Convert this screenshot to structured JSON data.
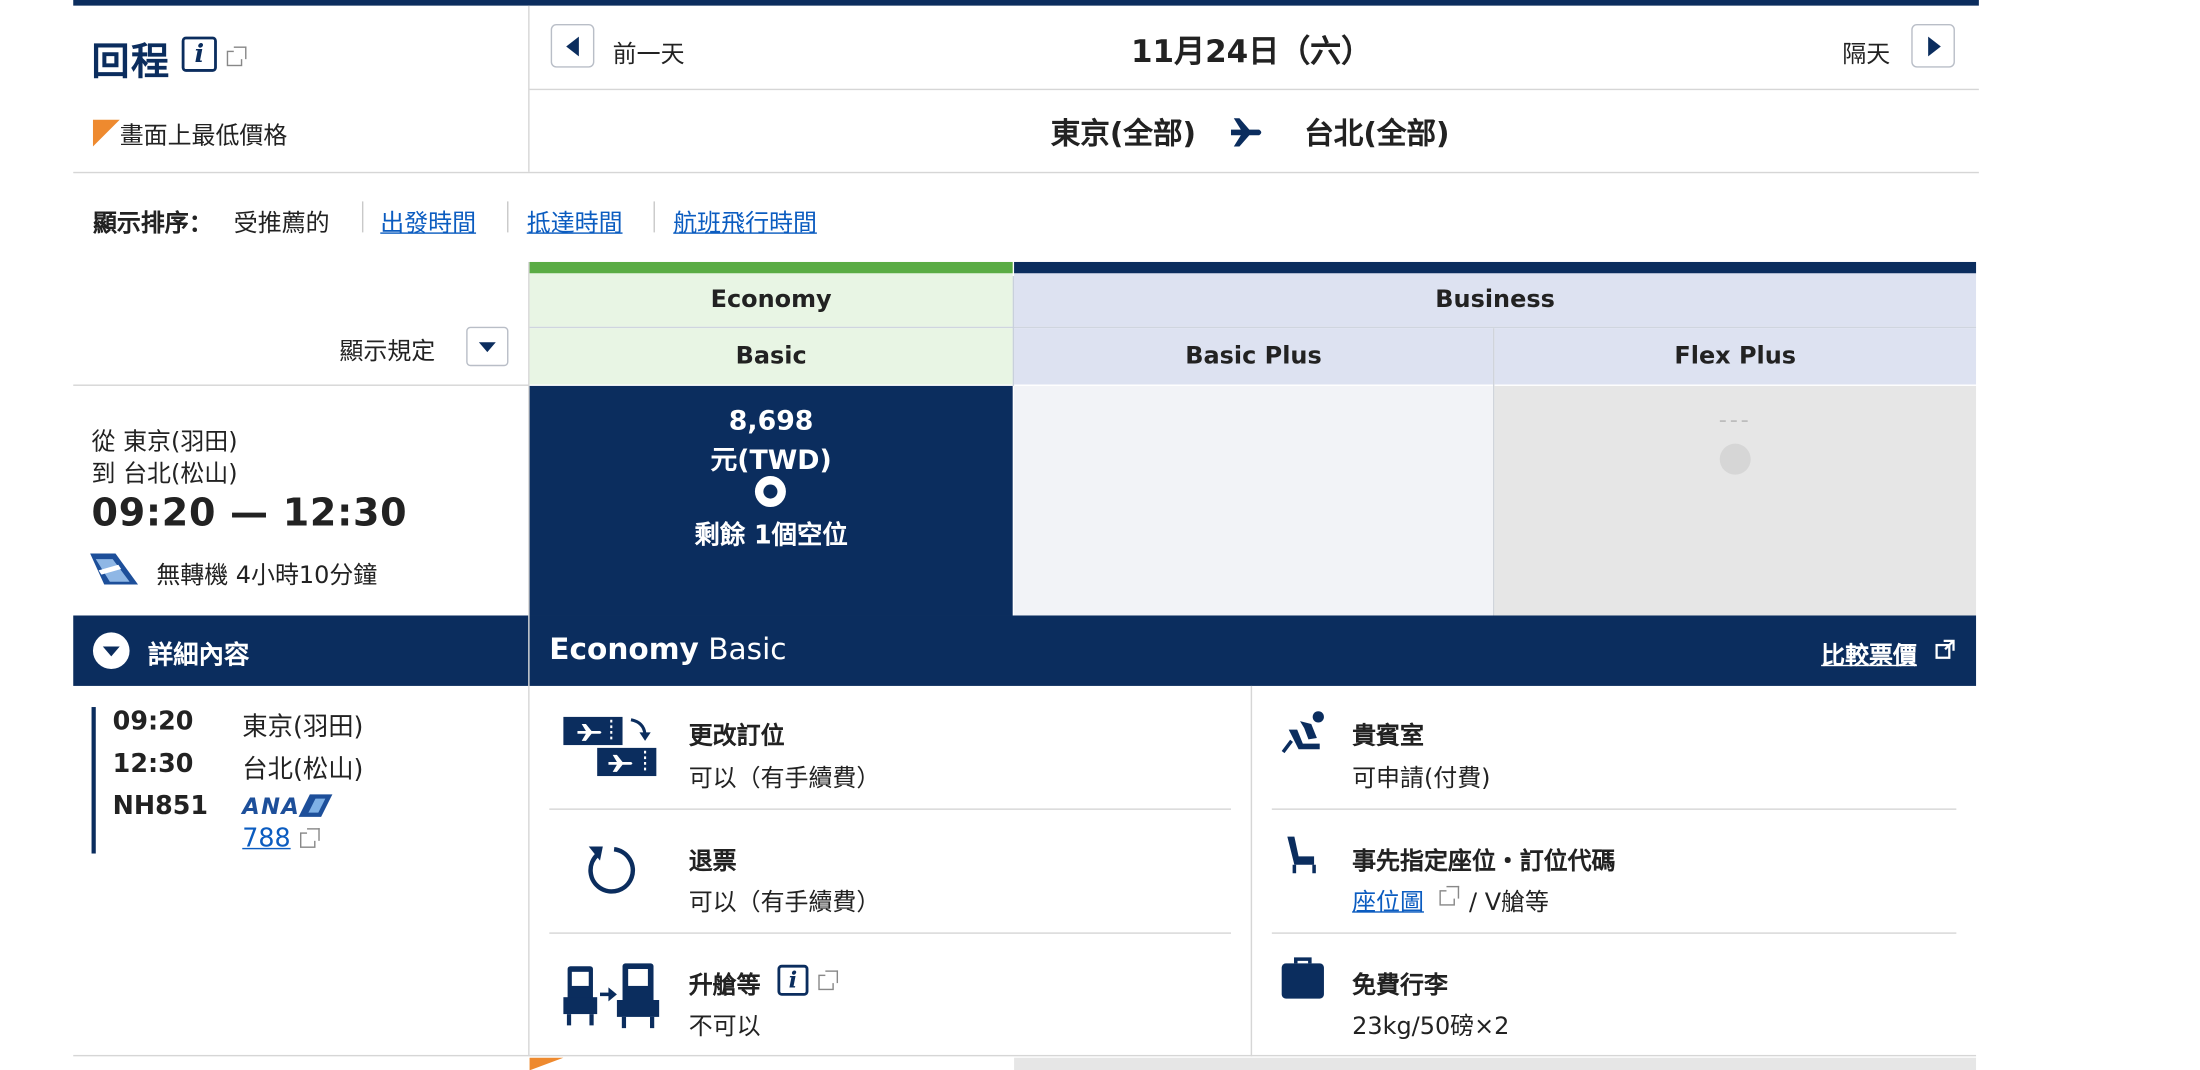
{
  "header": {
    "title": "回程",
    "lowest_price_label": "畫面上最低價格",
    "prev_label": "前一天",
    "next_label": "隔天",
    "date": "11月24日（六）",
    "origin": "東京(全部)",
    "destination": "台北(全部)"
  },
  "sort": {
    "label": "顯示排序：",
    "current": "受推薦的",
    "options": [
      "出發時間",
      "抵達時間",
      "航班飛行時間"
    ]
  },
  "rules_label": "顯示規定",
  "fare_classes": {
    "economy": "Economy",
    "business": "Business",
    "economy_basic": "Basic",
    "business_basic_plus": "Basic Plus",
    "business_flex_plus": "Flex Plus"
  },
  "colors": {
    "navy": "#0b2d5e",
    "economy_green": "#5aac44",
    "economy_tint": "#e8f5e4",
    "business_tint": "#dde2f1",
    "link": "#0b5cc0",
    "lowest_flag": "#ee8a2f"
  },
  "flight": {
    "from": "從 東京(羽田)",
    "to": "到 台北(松山)",
    "times": "09:20 — 12:30",
    "stops_duration": "無轉機 4小時10分鐘"
  },
  "price": {
    "amount": "8,698",
    "unit": "元(TWD)",
    "seats": "剩餘 1個空位"
  },
  "flex_plus_placeholder": "---",
  "details": {
    "toggle_label": "詳細內容",
    "segments": [
      {
        "time": "09:20",
        "place": "東京(羽田)"
      },
      {
        "time": "12:30",
        "place": "台北(松山)"
      }
    ],
    "flight_no": "NH851",
    "airline_logo": "ANA",
    "aircraft": "788"
  },
  "fare_detail": {
    "cabin": "Economy",
    "fare": "Basic",
    "compare_link": "比較票價",
    "features": [
      {
        "icon": "change-booking-icon",
        "title": "更改訂位",
        "value": "可以（有手續費）"
      },
      {
        "icon": "lounge-seat-icon",
        "title": "貴賓室",
        "value": "可申請(付費)"
      },
      {
        "icon": "refund-icon",
        "title": "退票",
        "value": "可以（有手續費）"
      },
      {
        "icon": "seat-icon",
        "title": "事先指定座位・訂位代碼",
        "value_link": "座位圖",
        "value": " / V艙等"
      },
      {
        "icon": "upgrade-icon",
        "title": "升艙等",
        "value": "不可以"
      },
      {
        "icon": "baggage-icon",
        "title": "免費行李",
        "value": "23kg/50磅×2"
      }
    ]
  }
}
